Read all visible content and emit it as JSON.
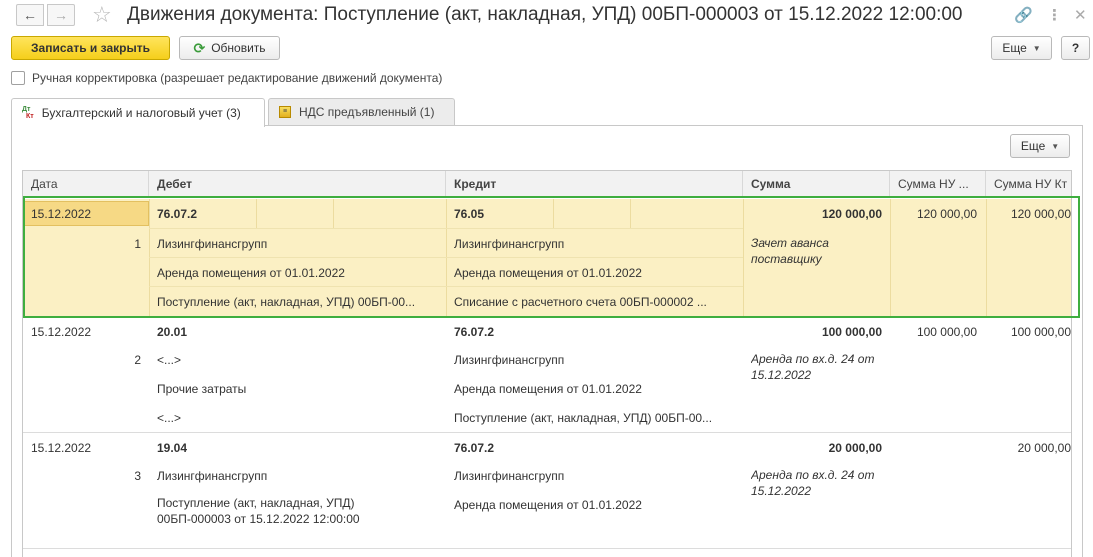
{
  "window": {
    "title": "Движения документа: Поступление (акт, накладная, УПД) 00БП-000003 от 15.12.2022 12:00:00",
    "back_icon": "arrow-left-icon",
    "forward_icon": "arrow-right-icon",
    "favorite_icon": "star-icon",
    "link_icon": "link-icon",
    "menu_icon": "more-vertical-icon",
    "close_icon": "close-icon"
  },
  "toolbar": {
    "save_close_label": "Записать и закрыть",
    "refresh_label": "Обновить",
    "more_label": "Еще",
    "help_label": "?"
  },
  "manual_correction": {
    "label": "Ручная корректировка (разрешает редактирование движений документа)",
    "checked": false
  },
  "tabs": [
    {
      "label": "Бухгалтерский и налоговый учет (3)",
      "active": true,
      "icon": "dt-kt-icon"
    },
    {
      "label": "НДС предъявленный (1)",
      "active": false,
      "icon": "nds-register-icon"
    }
  ],
  "grid_toolbar": {
    "more_label": "Еще"
  },
  "columns": {
    "date": "Дата",
    "debit": "Дебет",
    "credit": "Кредит",
    "sum": "Сумма",
    "sum_nu_dt": "Сумма НУ ...",
    "sum_nu_kt": "Сумма НУ Кт"
  },
  "rows": [
    {
      "date": "15.12.2022",
      "num": "1",
      "debit_account": "76.07.2",
      "debit_sub": [
        "Лизингфинансгрупп",
        "Аренда помещения от 01.01.2022",
        "Поступление (акт, накладная, УПД) 00БП-00..."
      ],
      "credit_account": "76.05",
      "credit_sub": [
        "Лизингфинансгрупп",
        "Аренда помещения от 01.01.2022",
        "Списание с расчетного счета 00БП-000002 ..."
      ],
      "sum": "120 000,00",
      "content": "Зачет аванса поставщику",
      "sum_nu_dt": "120 000,00",
      "sum_nu_kt": "120 000,00"
    },
    {
      "date": "15.12.2022",
      "num": "2",
      "debit_account": "20.01",
      "debit_sub": [
        "<...>",
        "Прочие затраты",
        "<...>"
      ],
      "credit_account": "76.07.2",
      "credit_sub": [
        "Лизингфинансгрупп",
        "Аренда помещения от 01.01.2022",
        "Поступление (акт, накладная, УПД) 00БП-00..."
      ],
      "sum": "100 000,00",
      "content": "Аренда по вх.д. 24 от 15.12.2022",
      "sum_nu_dt": "100 000,00",
      "sum_nu_kt": "100 000,00"
    },
    {
      "date": "15.12.2022",
      "num": "3",
      "debit_account": "19.04",
      "debit_sub": [
        "Лизингфинансгрупп",
        "Поступление (акт, накладная, УПД) 00БП-000003 от 15.12.2022 12:00:00"
      ],
      "credit_account": "76.07.2",
      "credit_sub": [
        "Лизингфинансгрупп",
        "Аренда помещения от 01.01.2022"
      ],
      "sum": "20 000,00",
      "content": "Аренда по вх.д. 24 от 15.12.2022",
      "sum_nu_dt": "",
      "sum_nu_kt": "20 000,00"
    }
  ]
}
